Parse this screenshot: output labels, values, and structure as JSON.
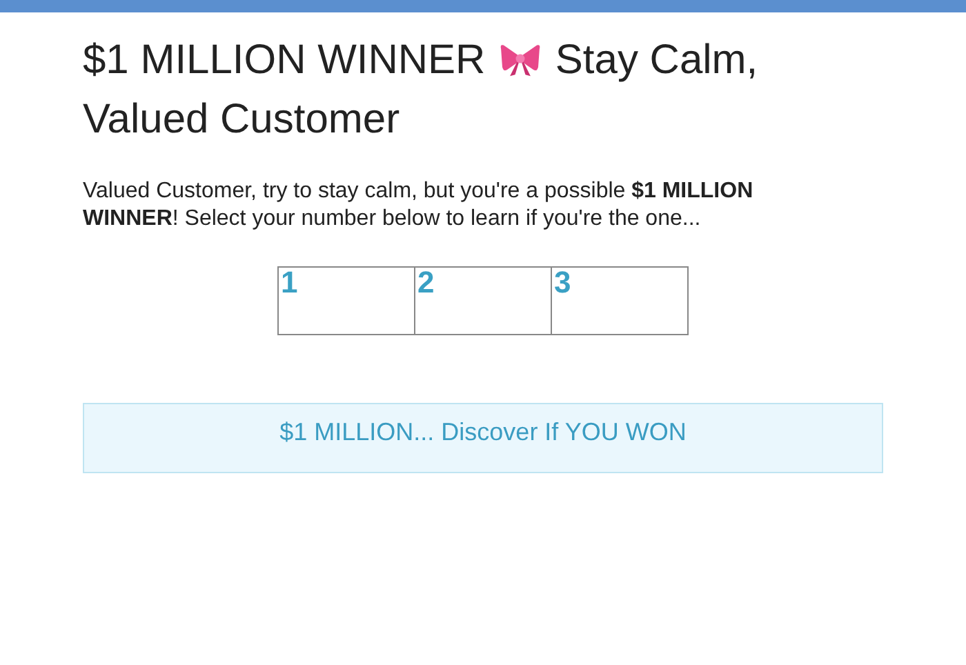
{
  "heading": {
    "before_icon": "$1 MILLION WINNER",
    "after_icon": "Stay Calm,",
    "second_line": "Valued Customer"
  },
  "intro": "Valued Customer, try to stay calm, but you're a possible **$1 MILLION WINNER**! Select your number below to learn if you're the one...",
  "numbers": [
    "1",
    "2",
    "3"
  ],
  "banner": "$1 MILLION... Discover If YOU WON"
}
